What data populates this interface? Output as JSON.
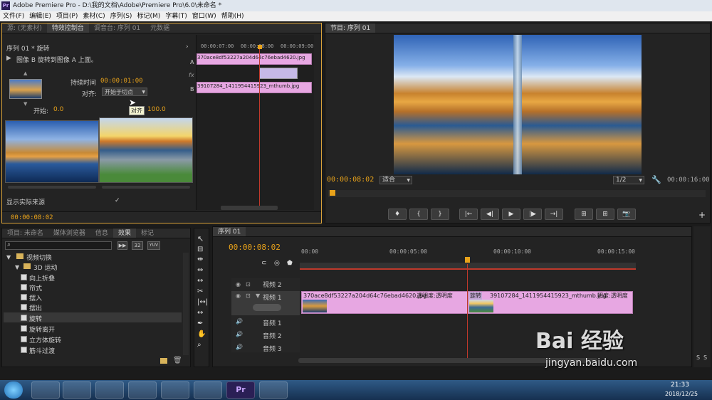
{
  "window": {
    "title": "Adobe Premiere Pro - D:\\我的文档\\Adobe\\Premiere Pro\\6.0\\未命名 *",
    "logo": "Pr"
  },
  "menu": [
    "文件(F)",
    "编辑(E)",
    "项目(P)",
    "素材(C)",
    "序列(S)",
    "标记(M)",
    "字幕(T)",
    "窗口(W)",
    "帮助(H)"
  ],
  "effect_controls": {
    "tabs": [
      "源: (无素材)",
      "特效控制台",
      "调音台: 序列 01",
      "元数据"
    ],
    "header": "序列 01 * 旋转",
    "description": "图像 B 旋转到图像 A 上面。",
    "duration_label": "持续时间",
    "duration_value": "00:00:01:00",
    "align_label": "对齐:",
    "align_value": "开始于切点",
    "tooltip": "对齐",
    "start_label": "开始:",
    "start_value": "0.0",
    "end_value": "100.0",
    "show_source_label": "显示实际来源",
    "time": "00:00:08:02",
    "mini_timecodes": [
      "00:00:07:00",
      "00:00:08:00",
      "00:00:09:00"
    ],
    "mini_clip_a": "370ace8df53227a204d64c76ebad4620.jpg",
    "mini_clip_b": "39107284_1411954415923_mthumb.jpg",
    "labels": {
      "a": "A",
      "fx": "fx",
      "b": "B"
    }
  },
  "program_monitor": {
    "tab": "节目: 序列 01",
    "current_time": "00:00:08:02",
    "fit": "适合",
    "resolution": "1/2",
    "duration": "00:00:16:00",
    "controls": [
      "♦",
      "{",
      "}",
      "|←",
      "◀|",
      "▶",
      "|▶",
      "→|",
      "⊞",
      "⊞",
      "📷"
    ]
  },
  "project_panel": {
    "tabs": [
      "项目: 未命名",
      "媒体浏览器",
      "信息",
      "效果",
      "标记"
    ],
    "tree_root": "视频切换",
    "tree_folder": "3D 运动",
    "items": [
      "向上折叠",
      "帘式",
      "摆入",
      "摆出",
      "旋转",
      "旋转离开",
      "立方体旋转",
      "筋斗过渡"
    ],
    "badges": [
      "32",
      "YUV"
    ]
  },
  "timeline": {
    "tab": "序列 01",
    "current_time": "00:00:08:02",
    "ruler": [
      "00:00",
      "00:00:05:00",
      "00:00:10:00",
      "00:00:15:00"
    ],
    "tracks_video": [
      "视频 2",
      "视频 1"
    ],
    "tracks_audio": [
      "音频 1",
      "音频 2",
      "音频 3"
    ],
    "clip1_label": "370ace8df53227a204d64c76ebad4620.jpg",
    "clip1_opacity": "透明度:透明度",
    "clip2_transition": "旋转",
    "clip2_label": "39107284_1411954415923_mthumb.jpg",
    "clip2_opacity": "明度:透明度"
  },
  "taskbar": {
    "time": "21:33",
    "date": "2018/12/25"
  },
  "watermark": {
    "text": "Bai 经验",
    "url": "jingyan.baidu.com"
  }
}
